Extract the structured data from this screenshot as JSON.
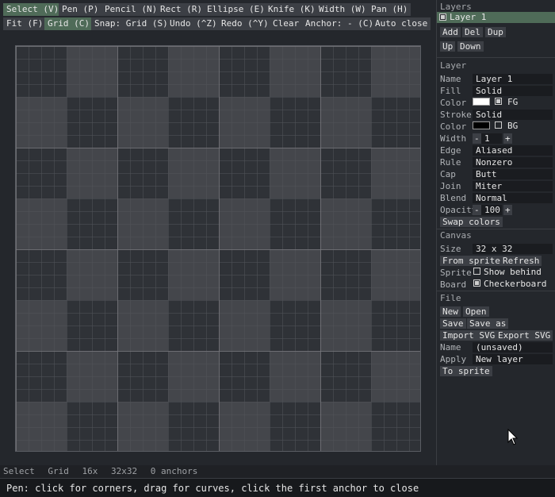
{
  "toolbar": {
    "row1": [
      "Select (V)",
      "Pen (P)",
      "Pencil (N)",
      "Rect (R)",
      "Ellipse (E)",
      "Knife (K)",
      "Width (W)",
      "Pan (H)"
    ],
    "row2": [
      "Fit (F)",
      "Grid (C)",
      "Snap: Grid (S)",
      "Undo (^Z)",
      "Redo (^Y)",
      "Clear",
      "Anchor: - (C)",
      "Auto close"
    ],
    "active": [
      "Select (V)",
      "Grid (C)"
    ]
  },
  "layers": {
    "title": "Layers",
    "items": [
      {
        "label": "Layer 1",
        "visible": true
      }
    ],
    "buttons": [
      "Add",
      "Del",
      "Dup",
      "Up",
      "Down"
    ]
  },
  "layer": {
    "title": "Layer",
    "name_label": "Name",
    "name_value": "Layer 1",
    "fill_label": "Fill",
    "fill_value": "Solid",
    "fill_color_label": "Color",
    "fill_color": "#ffffff",
    "fill_tag": "FG",
    "stroke_label": "Stroke",
    "stroke_value": "Solid",
    "stroke_color_label": "Color",
    "stroke_color": "#000000",
    "stroke_tag": "BG",
    "width_label": "Width",
    "width_minus": "-",
    "width_value": "1",
    "width_plus": "+",
    "edge_label": "Edge",
    "edge_value": "Aliased",
    "rule_label": "Rule",
    "rule_value": "Nonzero",
    "cap_label": "Cap",
    "cap_value": "Butt",
    "join_label": "Join",
    "join_value": "Miter",
    "blend_label": "Blend",
    "blend_value": "Normal",
    "opacity_label": "Opacity",
    "opacity_minus": "-",
    "opacity_value": "100",
    "opacity_plus": "+",
    "swap_label": "Swap colors"
  },
  "canvas": {
    "title": "Canvas",
    "size_label": "Size",
    "size_value": "32 x 32",
    "from_sprite": "From sprite",
    "refresh": "Refresh",
    "sprite_label": "Sprite",
    "show_behind": "Show behind",
    "show_behind_checked": false,
    "board_label": "Board",
    "checkerboard": "Checkerboard",
    "checkerboard_checked": true
  },
  "file": {
    "title": "File",
    "new": "New",
    "open": "Open",
    "save": "Save",
    "save_as": "Save as",
    "import_svg": "Import SVG",
    "export_svg": "Export SVG",
    "name_label": "Name",
    "name_value": "(unsaved)",
    "apply_label": "Apply",
    "apply_value": "New layer",
    "to_sprite": "To sprite"
  },
  "status": {
    "tool": "Select",
    "grid": "Grid",
    "zoom": "16x",
    "size": "32x32",
    "anchors": "0 anchors"
  },
  "hint": "Pen: click for corners, drag for curves, click the first anchor to close",
  "colors": {
    "accent": "#4f6b58",
    "background": "#24272c"
  }
}
